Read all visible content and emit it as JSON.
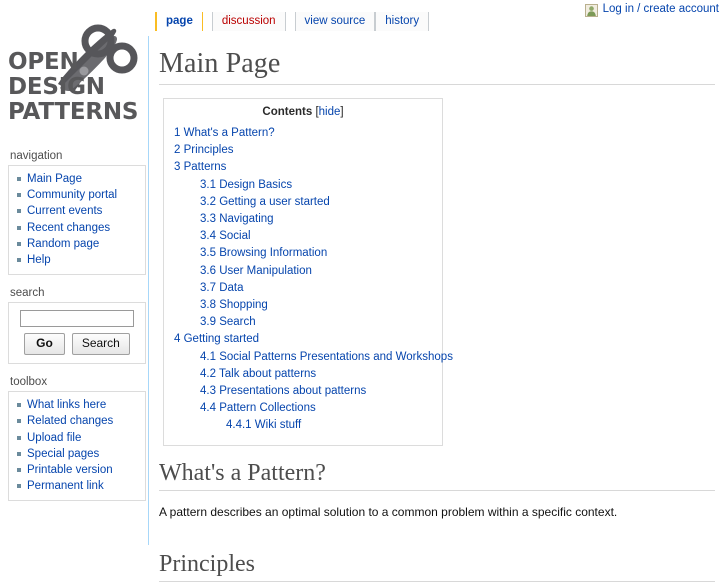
{
  "brand": {
    "line1": "OPEN",
    "line2": "DESIGN",
    "line3": "PATTERNS",
    "icon": "scissors-icon"
  },
  "personal": {
    "icon": "user-avatar-icon",
    "login_label": "Log in / create account"
  },
  "tabs": [
    {
      "label": "page",
      "state": "selected"
    },
    {
      "label": "discussion",
      "state": "new"
    },
    {
      "label": "view source",
      "state": "normal"
    },
    {
      "label": "history",
      "state": "normal"
    }
  ],
  "page": {
    "title": "Main Page"
  },
  "toc": {
    "title": "Contents",
    "toggle_open_bracket": "[",
    "toggle_label": "hide",
    "toggle_close_bracket": "]",
    "entries": [
      {
        "number": "1",
        "label": "What's a Pattern?",
        "level": 1
      },
      {
        "number": "2",
        "label": "Principles",
        "level": 1
      },
      {
        "number": "3",
        "label": "Patterns",
        "level": 1
      },
      {
        "number": "3.1",
        "label": "Design Basics",
        "level": 2
      },
      {
        "number": "3.2",
        "label": "Getting a user started",
        "level": 2
      },
      {
        "number": "3.3",
        "label": "Navigating",
        "level": 2
      },
      {
        "number": "3.4",
        "label": "Social",
        "level": 2
      },
      {
        "number": "3.5",
        "label": "Browsing Information",
        "level": 2
      },
      {
        "number": "3.6",
        "label": "User Manipulation",
        "level": 2
      },
      {
        "number": "3.7",
        "label": "Data",
        "level": 2
      },
      {
        "number": "3.8",
        "label": "Shopping",
        "level": 2
      },
      {
        "number": "3.9",
        "label": "Search",
        "level": 2
      },
      {
        "number": "4",
        "label": "Getting started",
        "level": 1
      },
      {
        "number": "4.1",
        "label": "Social Patterns Presentations and Workshops",
        "level": 2
      },
      {
        "number": "4.2",
        "label": "Talk about patterns",
        "level": 2
      },
      {
        "number": "4.3",
        "label": "Presentations about patterns",
        "level": 2
      },
      {
        "number": "4.4",
        "label": "Pattern Collections",
        "level": 2
      },
      {
        "number": "4.4.1",
        "label": "Wiki stuff",
        "level": 3
      }
    ]
  },
  "sections": {
    "whats_a_pattern_heading": "What's a Pattern?",
    "whats_a_pattern_text": "A pattern describes an optimal solution to a common problem within a specific context.",
    "principles_heading": "Principles"
  },
  "sidebar": {
    "navigation": {
      "title": "navigation",
      "items": [
        {
          "label": "Main Page"
        },
        {
          "label": "Community portal"
        },
        {
          "label": "Current events"
        },
        {
          "label": "Recent changes"
        },
        {
          "label": "Random page"
        },
        {
          "label": "Help"
        }
      ]
    },
    "search": {
      "title": "search",
      "input_value": "",
      "go_label": "Go",
      "search_label": "Search"
    },
    "toolbox": {
      "title": "toolbox",
      "items": [
        {
          "label": "What links here"
        },
        {
          "label": "Related changes"
        },
        {
          "label": "Upload file"
        },
        {
          "label": "Special pages"
        },
        {
          "label": "Printable version"
        },
        {
          "label": "Permanent link"
        }
      ]
    }
  },
  "colors": {
    "link": "#0645ad",
    "new_link": "#ba0000",
    "heading": "#4d4d4d",
    "brand": "#58585a",
    "tab_accent": "#fabd23",
    "bullet": "#6b8b9c"
  }
}
